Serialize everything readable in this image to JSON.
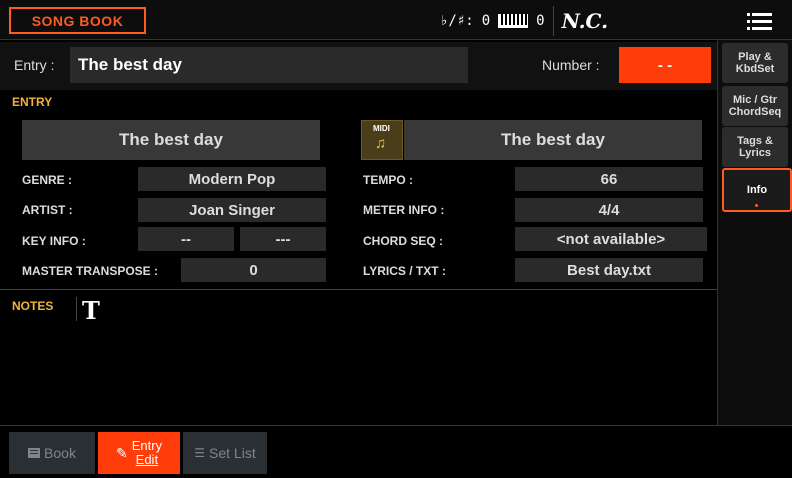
{
  "header": {
    "tab_label": "SONG BOOK",
    "accidental_label": "♭/♯:",
    "accidental_value": "0",
    "keyboard_value": "0",
    "chord": "N.C."
  },
  "entry_row": {
    "entry_label": "Entry :",
    "entry_value": "The best day",
    "number_label": "Number :",
    "number_value": "- -"
  },
  "side_tabs": [
    {
      "label": "Play & KbdSet"
    },
    {
      "label": "Mic / Gtr ChordSeq"
    },
    {
      "label": "Tags & Lyrics"
    },
    {
      "label": "Info"
    }
  ],
  "entry_section": {
    "header": "ENTRY",
    "title_left": "The best day",
    "midi_label": "MIDI",
    "title_right": "The best day",
    "genre_label": "GENRE :",
    "genre_value": "Modern Pop",
    "artist_label": "ARTIST :",
    "artist_value": "Joan Singer",
    "keyinfo_label": "KEY INFO :",
    "keyinfo_value1": "--",
    "keyinfo_value2": "---",
    "master_transpose_label": "MASTER TRANSPOSE :",
    "master_transpose_value": "0",
    "tempo_label": "TEMPO :",
    "tempo_value": "66",
    "meter_label": "METER INFO :",
    "meter_value": "4/4",
    "chordseq_label": "CHORD SEQ :",
    "chordseq_value": "<not available>",
    "lyrics_label": "LYRICS / TXT :",
    "lyrics_value": "Best day.txt"
  },
  "notes_section": {
    "header": "NOTES",
    "text_icon": "T"
  },
  "bottom_tabs": [
    {
      "label": "Book",
      "icon": "book-icon"
    },
    {
      "label_line1": "Entry",
      "label_line2": "Edit",
      "icon": "pencil-icon"
    },
    {
      "label": "Set List",
      "icon": "list-icon"
    }
  ],
  "colors": {
    "accent": "#ff3d0a",
    "section_header": "#f2b33d"
  }
}
